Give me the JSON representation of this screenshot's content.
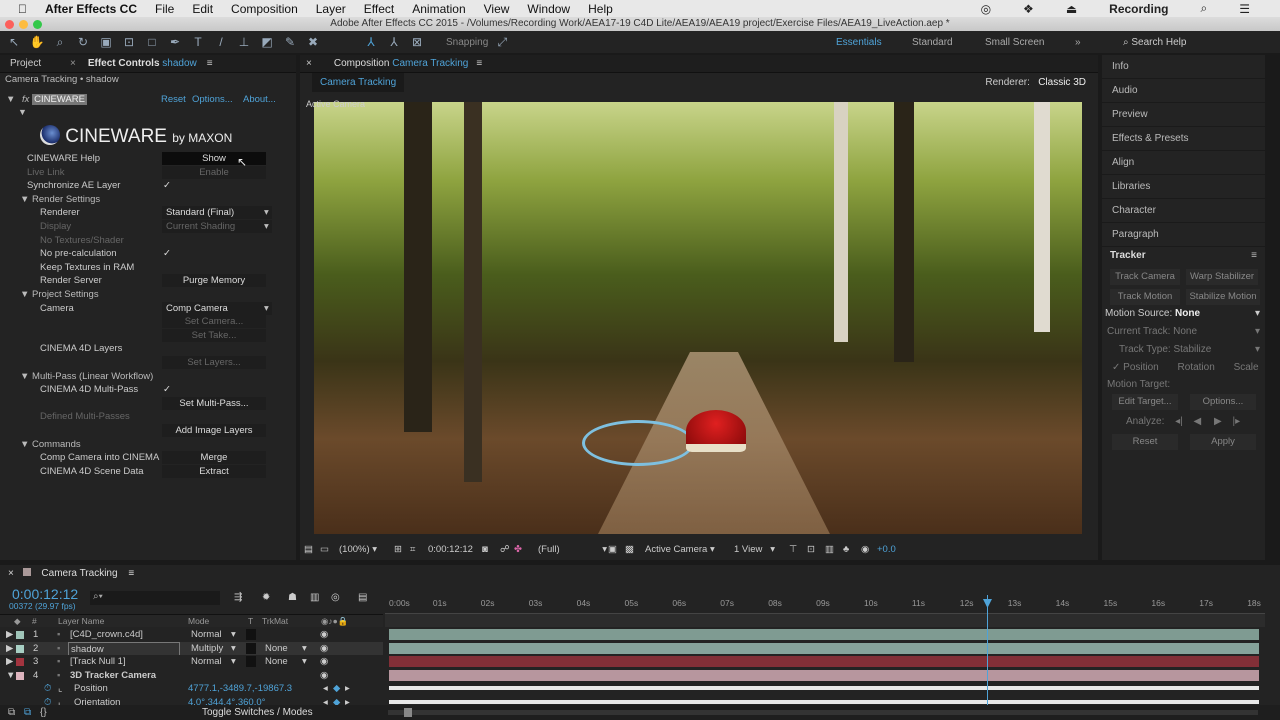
{
  "menubar": {
    "app": "After Effects CC",
    "items": [
      "File",
      "Edit",
      "Composition",
      "Layer",
      "Effect",
      "Animation",
      "View",
      "Window",
      "Help"
    ],
    "right_label": "Recording"
  },
  "window_title": "Adobe After Effects CC 2015 - /Volumes/Recording Work/AEA17-19 C4D Lite/AEA19/AEA19 project/Exercise Files/AEA19_LiveAction.aep *",
  "toolbar": {
    "snapping": "Snapping",
    "workspaces": [
      "Essentials",
      "Standard",
      "Small Screen"
    ],
    "search_help": "Search Help"
  },
  "left_panel": {
    "tab_project": "Project",
    "tab_effect": "Effect Controls",
    "tab_effect_layer": "shadow",
    "breadcrumb": "Camera Tracking • shadow",
    "effect_name": "CINEWARE",
    "reset": "Reset",
    "options": "Options...",
    "about": "About...",
    "logo": "CINEWARE by MAXON",
    "rows": [
      {
        "label": "CINEWARE Help",
        "value": "Show",
        "indent": 0
      },
      {
        "label": "Live Link",
        "value": "Enable",
        "indent": 0,
        "dim": true
      },
      {
        "label": "Synchronize AE Layer",
        "value": "✓",
        "indent": 0
      },
      {
        "label": "▼ Render Settings",
        "value": "",
        "indent": -1
      },
      {
        "label": "Renderer",
        "value": "Standard (Final)",
        "indent": 1,
        "dropdown": true
      },
      {
        "label": "Display",
        "value": "Current Shading",
        "indent": 1,
        "dim": true,
        "dropdown": true
      },
      {
        "label": "No Textures/Shader",
        "value": "",
        "indent": 1,
        "dim": true
      },
      {
        "label": "No pre-calculation",
        "value": "✓",
        "indent": 1
      },
      {
        "label": "Keep Textures in RAM",
        "value": "",
        "indent": 1
      },
      {
        "label": "Render Server",
        "value": "Purge Memory",
        "indent": 1
      },
      {
        "label": "▼ Project Settings",
        "value": "",
        "indent": -1
      },
      {
        "label": "Camera",
        "value": "Comp Camera",
        "indent": 1,
        "dropdown": true
      },
      {
        "label": "",
        "value": "Set Camera...",
        "indent": 1,
        "dim": true
      },
      {
        "label": "",
        "value": "Set Take...",
        "indent": 1,
        "dim": true
      },
      {
        "label": "CINEMA 4D Layers",
        "value": "",
        "indent": 1
      },
      {
        "label": "",
        "value": "Set Layers...",
        "indent": 1,
        "dim": true
      },
      {
        "label": "▼ Multi-Pass (Linear Workflow)",
        "value": "",
        "indent": -1
      },
      {
        "label": "CINEMA 4D Multi-Pass",
        "value": "✓",
        "indent": 1
      },
      {
        "label": "",
        "value": "Set Multi-Pass...",
        "indent": 1
      },
      {
        "label": "Defined Multi-Passes",
        "value": "",
        "indent": 1,
        "dim": true
      },
      {
        "label": "",
        "value": "Add Image Layers",
        "indent": 1
      },
      {
        "label": "▼ Commands",
        "value": "",
        "indent": -1
      },
      {
        "label": "Comp Camera into CINEMA",
        "value": "Merge",
        "indent": 1
      },
      {
        "label": "CINEMA 4D Scene Data",
        "value": "Extract",
        "indent": 1
      }
    ]
  },
  "composition": {
    "tab": "Composition",
    "comp_name": "Camera Tracking",
    "subtab": "Camera Tracking",
    "renderer_label": "Renderer:",
    "renderer": "Classic 3D",
    "view_label": "Active Camera",
    "footer": {
      "zoom": "(100%)",
      "timecode": "0:00:12:12",
      "resolution": "(Full)",
      "camera": "Active Camera",
      "views": "1 View",
      "exposure": "+0.0"
    }
  },
  "right_panel": {
    "items": [
      "Info",
      "Audio",
      "Preview",
      "Effects & Presets",
      "Align",
      "Libraries",
      "Character",
      "Paragraph"
    ],
    "tracker": {
      "title": "Tracker",
      "track_camera": "Track Camera",
      "warp_stabilizer": "Warp Stabilizer",
      "track_motion": "Track Motion",
      "stabilize_motion": "Stabilize Motion",
      "motion_source_label": "Motion Source:",
      "motion_source": "None",
      "current_track_label": "Current Track:",
      "current_track": "None",
      "track_type_label": "Track Type:",
      "track_type": "Stabilize",
      "position": "Position",
      "rotation": "Rotation",
      "scale": "Scale",
      "position_checked": true,
      "motion_target": "Motion Target:",
      "edit_target": "Edit Target...",
      "options": "Options...",
      "analyze": "Analyze:",
      "reset": "Reset",
      "apply": "Apply"
    }
  },
  "timeline": {
    "tab": "Camera Tracking",
    "timecode": "0:00:12:12",
    "frame_info": "00372 (29.97 fps)",
    "cols": {
      "num": "#",
      "name": "Layer Name",
      "mode": "Mode",
      "t": "T",
      "trkmat": "TrkMat"
    },
    "ruler": [
      "0:00s",
      "01s",
      "02s",
      "03s",
      "04s",
      "05s",
      "06s",
      "07s",
      "08s",
      "09s",
      "10s",
      "11s",
      "12s",
      "13s",
      "14s",
      "15s",
      "16s",
      "17s",
      "18s"
    ],
    "playhead_seconds": 12.4,
    "layers": [
      {
        "num": "1",
        "name": "[C4D_crown.c4d]",
        "mode": "Normal",
        "trkmat": "",
        "color": "#9fc4b8"
      },
      {
        "num": "2",
        "name": "shadow",
        "mode": "Multiply",
        "trkmat": "None",
        "color": "#a8cfc4"
      },
      {
        "num": "3",
        "name": "[Track Null 1]",
        "mode": "Normal",
        "trkmat": "None",
        "color": "#a3343f"
      },
      {
        "num": "4",
        "name": "3D Tracker Camera",
        "mode": "",
        "trkmat": "",
        "color": "#dcb3bd"
      }
    ],
    "props": [
      {
        "name": "Position",
        "value": "4777.1,-3489.7,-19867.3"
      },
      {
        "name": "Orientation",
        "value": "4.0°,344.4°,360.0°"
      }
    ],
    "toggle": "Toggle Switches / Modes"
  }
}
